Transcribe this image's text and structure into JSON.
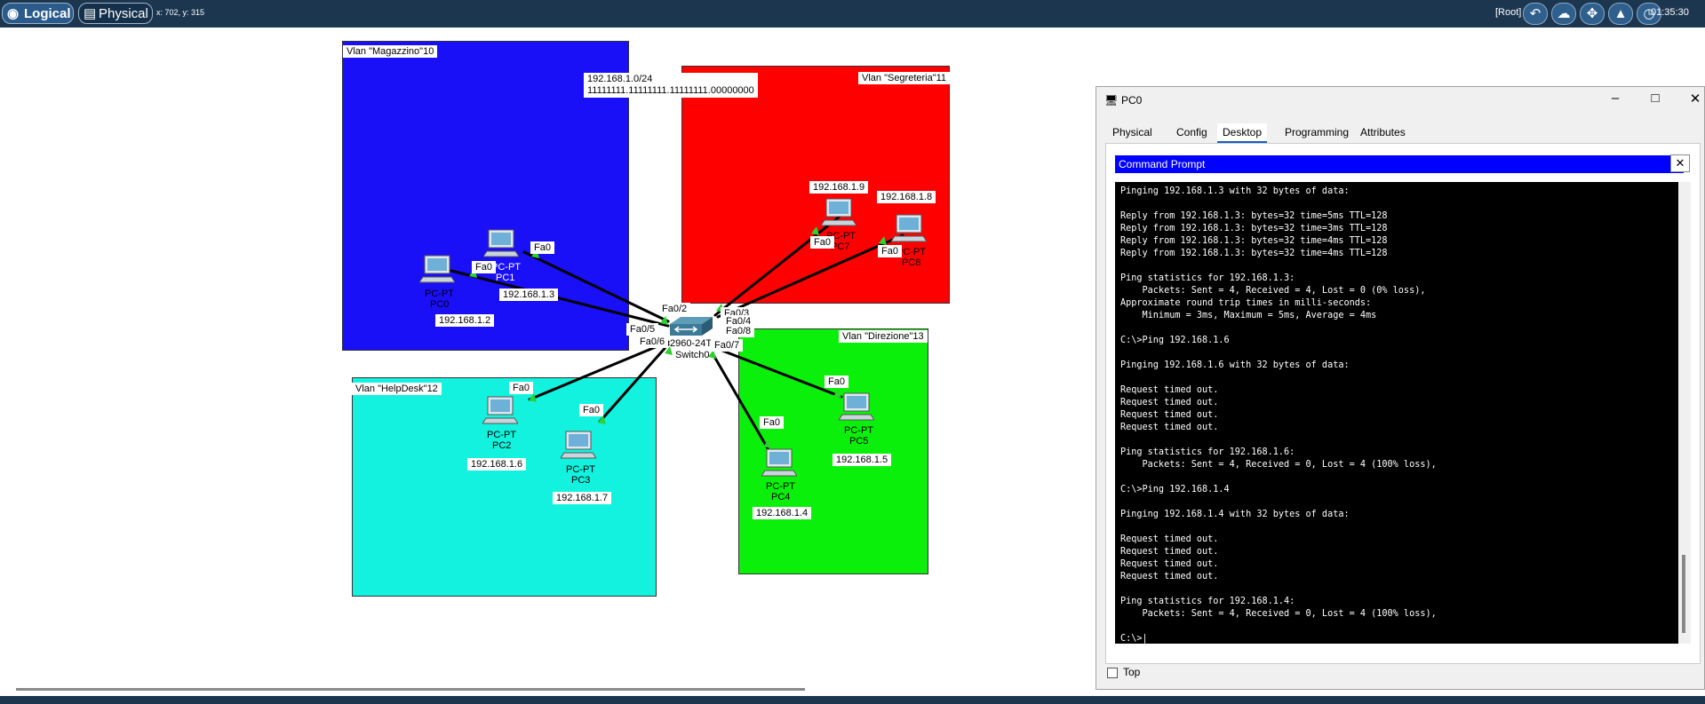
{
  "topbar": {
    "logical_label": "Logical",
    "physical_label": "Physical",
    "coords": "x: 702, y: 315",
    "root_label": "[Root]",
    "clock": "01:35:30"
  },
  "topology": {
    "vlans": {
      "magazzino": "Vlan \"Magazzino\"10",
      "segreteria": "Vlan \"Segreteria\"11",
      "helpdesk": "Vlan \"HelpDesk\"12",
      "direzione": "Vlan \"Direzione\"13"
    },
    "network_note": {
      "line1": "192.168.1.0/24",
      "line2": "11111111.11111111.11111111.00000000"
    },
    "switch": {
      "model": "2960-24TT",
      "name": "Switch0"
    },
    "ports": [
      "Fa0/2",
      "Fa0/3",
      "Fa0/4",
      "Fa0/5",
      "Fa0/6",
      "Fa0/7",
      "Fa0/8"
    ],
    "pcs": [
      {
        "type": "PC-PT",
        "name": "PC0",
        "ip": "192.168.1.2",
        "port": "Fa0"
      },
      {
        "type": "PC-PT",
        "name": "PC1",
        "ip": "192.168.1.3",
        "port": "Fa0"
      },
      {
        "type": "PC-PT",
        "name": "PC2",
        "ip": "192.168.1.6",
        "port": "Fa0"
      },
      {
        "type": "PC-PT",
        "name": "PC3",
        "ip": "192.168.1.7",
        "port": "Fa0"
      },
      {
        "type": "PC-PT",
        "name": "PC4",
        "ip": "192.168.1.4",
        "port": "Fa0"
      },
      {
        "type": "PC-PT",
        "name": "PC5",
        "ip": "192.168.1.5",
        "port": "Fa0"
      },
      {
        "type": "PC-PT",
        "name": "PC7",
        "ip": "192.168.1.9",
        "port": "Fa0"
      },
      {
        "type": "PC-PT",
        "name": "PC8",
        "ip": "192.168.1.8",
        "port": "Fa0"
      }
    ]
  },
  "window": {
    "title": "PC0",
    "tabs": [
      "Physical",
      "Config",
      "Desktop",
      "Programming",
      "Attributes"
    ],
    "active_tab": "Desktop",
    "cmd_title": "Command Prompt",
    "terminal_text": "Pinging 192.168.1.3 with 32 bytes of data:\n\nReply from 192.168.1.3: bytes=32 time=5ms TTL=128\nReply from 192.168.1.3: bytes=32 time=3ms TTL=128\nReply from 192.168.1.3: bytes=32 time=4ms TTL=128\nReply from 192.168.1.3: bytes=32 time=4ms TTL=128\n\nPing statistics for 192.168.1.3:\n    Packets: Sent = 4, Received = 4, Lost = 0 (0% loss),\nApproximate round trip times in milli-seconds:\n    Minimum = 3ms, Maximum = 5ms, Average = 4ms\n\nC:\\>Ping 192.168.1.6\n\nPinging 192.168.1.6 with 32 bytes of data:\n\nRequest timed out.\nRequest timed out.\nRequest timed out.\nRequest timed out.\n\nPing statistics for 192.168.1.6:\n    Packets: Sent = 4, Received = 0, Lost = 4 (100% loss),\n\nC:\\>Ping 192.168.1.4\n\nPinging 192.168.1.4 with 32 bytes of data:\n\nRequest timed out.\nRequest timed out.\nRequest timed out.\nRequest timed out.\n\nPing statistics for 192.168.1.4:\n    Packets: Sent = 4, Received = 0, Lost = 4 (100% loss),\n\nC:\\>|",
    "top_checkbox_label": "Top"
  },
  "colors": {
    "magazzino": "#1a10f8",
    "segreteria": "#ff0000",
    "helpdesk": "#12f2de",
    "direzione": "#0af00a",
    "topbar": "#1d3650",
    "cmd_header": "#0000ff"
  },
  "icons": [
    "logical-icon",
    "physical-icon",
    "undo-icon",
    "cloud-icon",
    "move-icon",
    "image-icon",
    "clock-icon"
  ]
}
